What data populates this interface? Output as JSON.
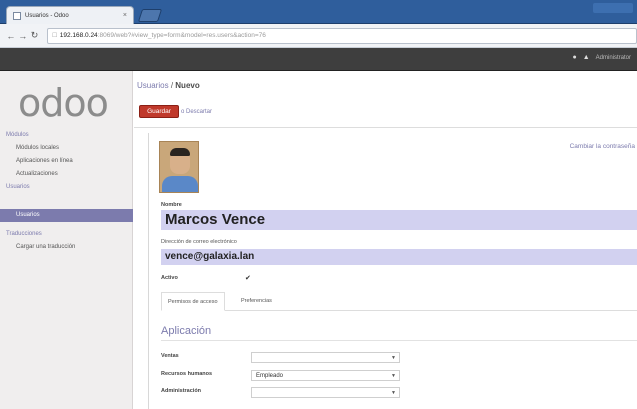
{
  "browser": {
    "tab_title": "Usuarios - Odoo",
    "tab_close": "×",
    "url_host": "192.168.0.24",
    "url_path": ":8069/web?#view_type=form&model=res.users&action=76"
  },
  "topbar": {
    "user_label": "Administrator"
  },
  "logo": "odoo",
  "sidebar": {
    "sections": [
      {
        "label": "Módulos",
        "items": [
          "Módulos locales",
          "Aplicaciones en línea",
          "Actualizaciones"
        ]
      },
      {
        "label": "Usuarios",
        "items": [
          "Usuarios"
        ]
      },
      {
        "label": "Traducciones",
        "items": [
          "Cargar una traducción"
        ]
      }
    ],
    "active_item": "Usuarios"
  },
  "breadcrumb": {
    "parent": "Usuarios",
    "separator": "/",
    "current": "Nuevo"
  },
  "actions": {
    "save": "Guardar",
    "discard": "o Descartar"
  },
  "form": {
    "change_password": "Cambiar la contraseña",
    "name_label": "Nombre",
    "name_value": "Marcos Vence",
    "email_label": "Dirección de correo electrónico",
    "email_value": "vence@galaxia.lan",
    "active_label": "Activo",
    "active_check": "✔",
    "tabs": [
      "Permisos de acceso",
      "Preferencias"
    ],
    "section_title": "Aplicación",
    "fields": [
      {
        "label": "Ventas",
        "value": ""
      },
      {
        "label": "Recursos humanos",
        "value": "Empleado"
      },
      {
        "label": "Administración",
        "value": ""
      }
    ]
  },
  "colors": {
    "accent": "#7c7bad",
    "save_button": "#c0392b",
    "topbar": "#3e3e3e",
    "field_highlight": "#d2d1f0"
  }
}
